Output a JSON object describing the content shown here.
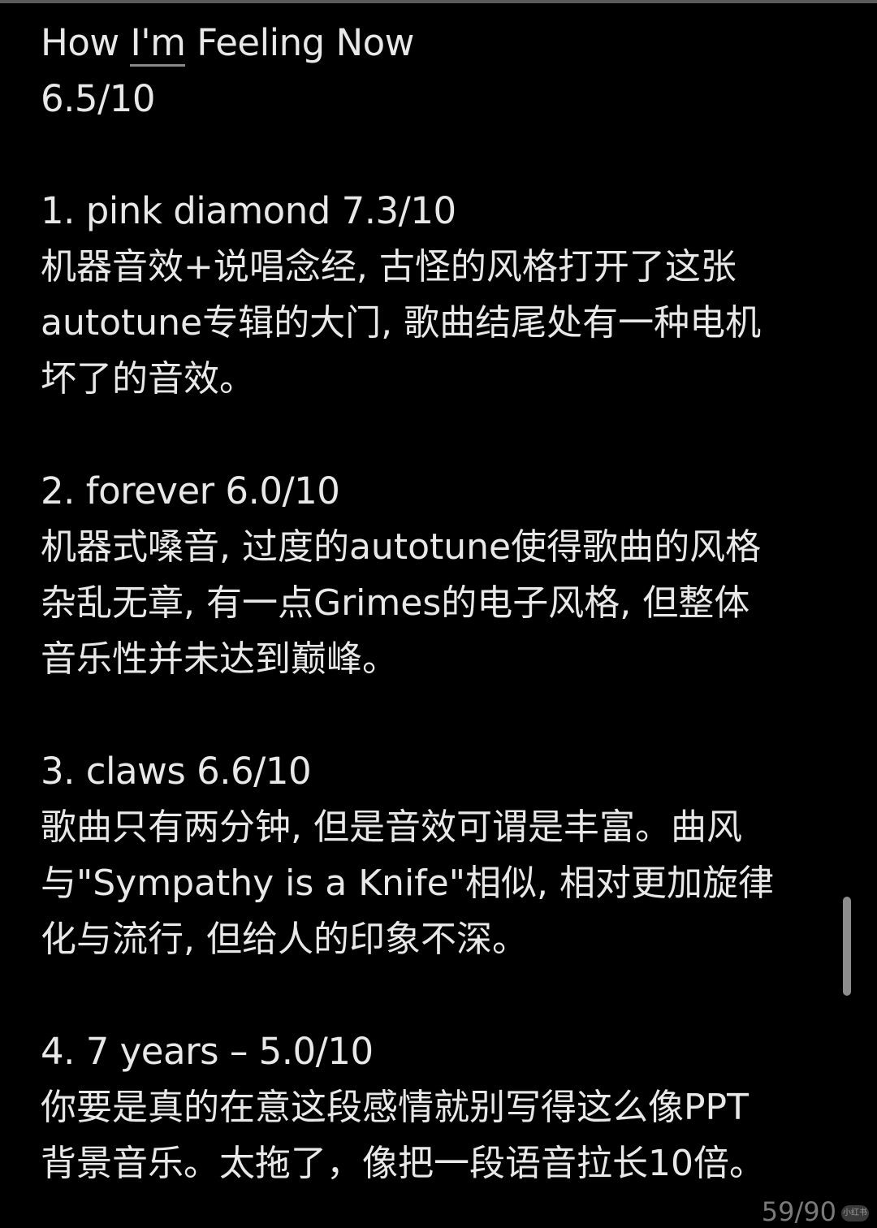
{
  "note": {
    "title_prefix": "How ",
    "title_underlined": "I'm",
    "title_suffix": " Feeling Now",
    "album_score": "6.5/10",
    "tracks": [
      {
        "heading": "1. pink diamond 7.3/10",
        "lines": [
          "机器音效+说唱念经, 古怪的风格打开了这张",
          "autotune专辑的大门, 歌曲结尾处有一种电机",
          "坏了的音效。"
        ]
      },
      {
        "heading": "2. forever 6.0/10",
        "lines": [
          "机器式嗓音, 过度的autotune使得歌曲的风格",
          "杂乱无章, 有一点Grimes的电子风格, 但整体",
          "音乐性并未达到巅峰。"
        ]
      },
      {
        "heading": "3. claws 6.6/10",
        "lines": [
          "歌曲只有两分钟, 但是音效可谓是丰富。曲风",
          "与\"Sympathy is a Knife\"相似, 相对更加旋律",
          "化与流行, 但给人的印象不深。"
        ]
      },
      {
        "heading": "4. 7 years – 5.0/10",
        "lines": [
          "你要是真的在意这段感情就别写得这么像PPT",
          "背景音乐。太拖了，像把一段语音拉长10倍。"
        ]
      }
    ]
  },
  "page_indicator": "59/90",
  "watermark": "小红书"
}
